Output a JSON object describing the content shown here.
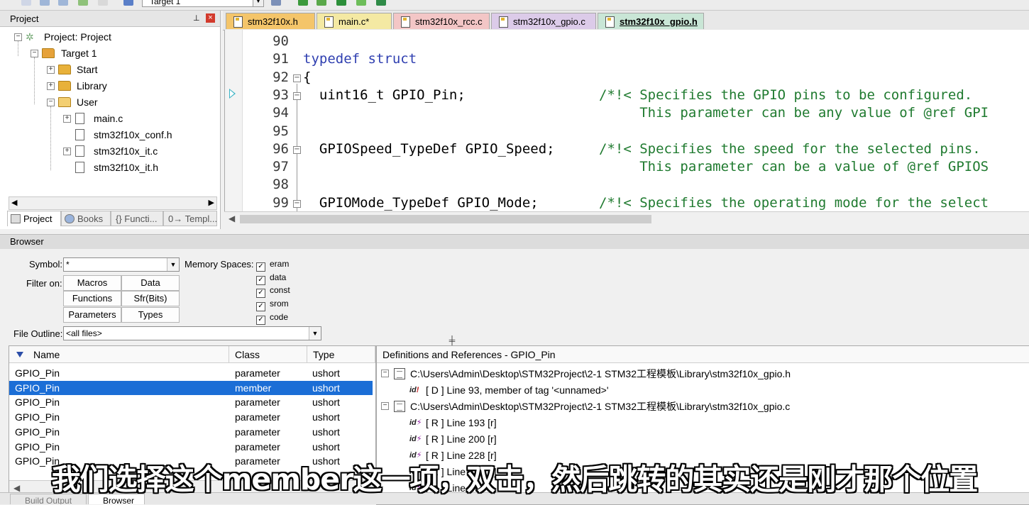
{
  "colors": {
    "keyword": "#2f3fb0",
    "comment": "#1f7a2f",
    "selection": "#1b6ed6"
  },
  "toolbar": {
    "target": "Target 1"
  },
  "project": {
    "title": "Project",
    "tree": [
      {
        "label": "Project: Project",
        "icon": "project-icon"
      },
      {
        "label": "Target 1",
        "icon": "target-icon"
      },
      {
        "label": "Start",
        "icon": "folder-icon"
      },
      {
        "label": "Library",
        "icon": "folder-icon"
      },
      {
        "label": "User",
        "icon": "folder-icon"
      },
      {
        "label": "main.c",
        "icon": "file-icon"
      },
      {
        "label": "stm32f10x_conf.h",
        "icon": "file-icon"
      },
      {
        "label": "stm32f10x_it.c",
        "icon": "file-icon"
      },
      {
        "label": "stm32f10x_it.h",
        "icon": "file-icon"
      }
    ],
    "tabs": [
      "Project",
      "Books",
      "{} Functi...",
      "0→ Templ..."
    ]
  },
  "editor": {
    "tabs": [
      {
        "label": "stm32f10x.h",
        "color": "#f4c56a"
      },
      {
        "label": "main.c*",
        "color": "#f4e9a3"
      },
      {
        "label": "stm32f10x_rcc.c",
        "color": "#f3c6c6"
      },
      {
        "label": "stm32f10x_gpio.c",
        "color": "#dccbe9"
      },
      {
        "label": "stm32f10x_gpio.h",
        "color": "#c9e6d6"
      }
    ],
    "lines": [
      {
        "num": "90",
        "code": "",
        "comment": ""
      },
      {
        "num": "91",
        "code": "typedef struct",
        "comment": ""
      },
      {
        "num": "92",
        "code": "{",
        "comment": ""
      },
      {
        "num": "93",
        "code": "  uint16_t GPIO_Pin;",
        "comment": "/*!< Specifies the GPIO pins to be configured."
      },
      {
        "num": "94",
        "code": "",
        "comment": "     This parameter can be any value of @ref GPI"
      },
      {
        "num": "95",
        "code": "",
        "comment": ""
      },
      {
        "num": "96",
        "code": "  GPIOSpeed_TypeDef GPIO_Speed;",
        "comment": "/*!< Specifies the speed for the selected pins."
      },
      {
        "num": "97",
        "code": "",
        "comment": "     This parameter can be a value of @ref GPIOS"
      },
      {
        "num": "98",
        "code": "",
        "comment": ""
      },
      {
        "num": "99",
        "code": "  GPIOMode_TypeDef GPIO_Mode;",
        "comment": "/*!< Specifies the operating mode for the select"
      }
    ]
  },
  "browser": {
    "title": "Browser",
    "symbol_label": "Symbol:",
    "symbol_value": "*",
    "filter_label": "Filter on:",
    "filters": [
      "Macros",
      "Data",
      "Functions",
      "Sfr(Bits)",
      "Parameters",
      "Types"
    ],
    "memory_label": "Memory Spaces:",
    "memory": [
      "eram",
      "data",
      "const",
      "srom",
      "code"
    ],
    "file_outline_label": "File Outline:",
    "file_outline_value": "<all files>",
    "columns": [
      "Name",
      "Class",
      "Type"
    ],
    "rows": [
      [
        "GPIO_Pin",
        "parameter",
        "ushort"
      ],
      [
        "GPIO_Pin",
        "member",
        "ushort"
      ],
      [
        "GPIO_Pin",
        "parameter",
        "ushort"
      ],
      [
        "GPIO_Pin",
        "parameter",
        "ushort"
      ],
      [
        "GPIO_Pin",
        "parameter",
        "ushort"
      ],
      [
        "GPIO_Pin",
        "parameter",
        "ushort"
      ],
      [
        "GPIO_Pin",
        "parameter",
        "ushort"
      ]
    ],
    "refs_title": "Definitions and References - GPIO_Pin",
    "refs": [
      {
        "text": "C:\\Users\\Admin\\Desktop\\STM32Project\\2-1 STM32工程模板\\Library\\stm32f10x_gpio.h",
        "kind": "file"
      },
      {
        "text": "[ D ] Line 93, member of tag '<unnamed>'",
        "kind": "def"
      },
      {
        "text": "C:\\Users\\Admin\\Desktop\\STM32Project\\2-1 STM32工程模板\\Library\\stm32f10x_gpio.c",
        "kind": "file"
      },
      {
        "text": "[ R ] Line 193 [r]",
        "kind": "ref"
      },
      {
        "text": "[ R ] Line 200 [r]",
        "kind": "ref"
      },
      {
        "text": "[ R ] Line 228 [r]",
        "kind": "ref"
      },
      {
        "text": "[ R ] Line 235 [r]",
        "kind": "ref"
      },
      {
        "text": "[ R ] Line [w]",
        "kind": "ref"
      }
    ]
  },
  "bottom_tabs": [
    "Build Output",
    "Browser"
  ],
  "subtitle": "我们选择这个member这一项，双击，然后跳转的其实还是刚才那个位置"
}
